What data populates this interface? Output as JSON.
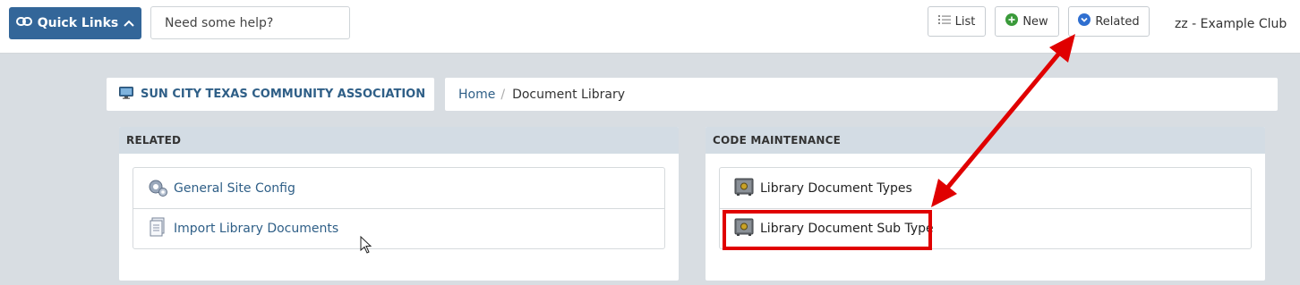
{
  "topbar": {
    "quick_links_label": "Quick Links",
    "help_placeholder": "Need some help?",
    "list_label": "List",
    "new_label": "New",
    "related_label": "Related",
    "club_name": "zz - Example Club"
  },
  "org": {
    "name": "SUN CITY TEXAS COMMUNITY ASSOCIATION"
  },
  "breadcrumb": {
    "home": "Home",
    "separator": "/",
    "current": "Document Library"
  },
  "related_panel": {
    "title": "RELATED",
    "items": [
      {
        "label": "General Site Config",
        "icon": "gears-icon"
      },
      {
        "label": "Import Library Documents",
        "icon": "document-stack-icon"
      }
    ]
  },
  "code_panel": {
    "title": "CODE MAINTENANCE",
    "items": [
      {
        "label": "Library Document Types",
        "icon": "safe-icon"
      },
      {
        "label": "Library Document Sub Type",
        "icon": "safe-icon"
      }
    ]
  },
  "colors": {
    "primary": "#336699",
    "link": "#2f5f87",
    "panel_header": "#d3dce4",
    "annotation_red": "#e00000",
    "new_green": "#3a9a3a",
    "related_blue": "#2f6fd0"
  }
}
